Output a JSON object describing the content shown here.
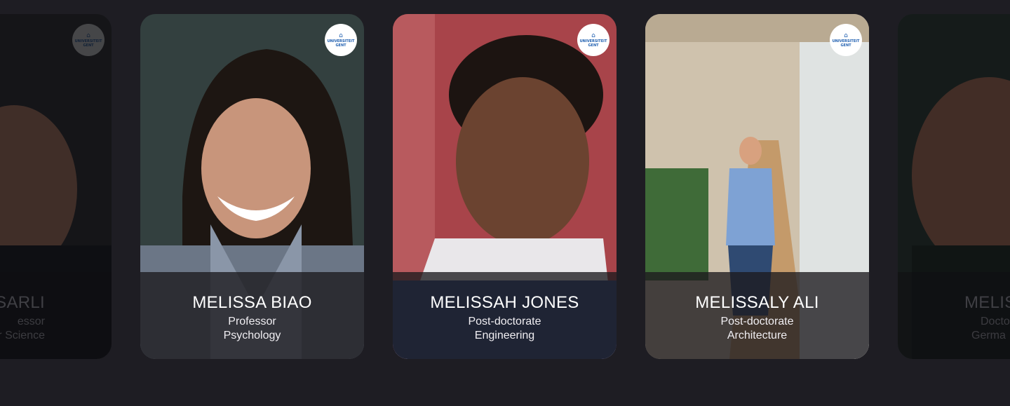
{
  "carousel": {
    "cards": [
      {
        "name": "SSARLI",
        "role": "essor",
        "dept": "r Science",
        "badge_crest": "⌂",
        "badge_text": [
          "UNIVERSITEIT",
          "GENT"
        ],
        "badge_icon": "university-logo"
      },
      {
        "name": "MELISSA BIAO",
        "role": "Professor",
        "dept": "Psychology",
        "badge_crest": "⌂",
        "badge_text": [
          "UNIVERSITEIT",
          "GENT"
        ],
        "badge_icon": "university-logo"
      },
      {
        "name": "MELISSAH JONES",
        "role": "Post-doctorate",
        "dept": "Engineering",
        "badge_crest": "⌂",
        "badge_text": [
          "UNIVERSITEIT",
          "GENT"
        ],
        "badge_icon": "university-logo"
      },
      {
        "name": "MELISSALY ALI",
        "role": "Post-doctorate",
        "dept": "Architecture",
        "badge_crest": "⌂",
        "badge_text": [
          "UNIVERSITEIT",
          "GENT"
        ],
        "badge_icon": "university-logo"
      },
      {
        "name": "MELIS",
        "role": "Docto",
        "dept": "Germa",
        "badge_crest": "",
        "badge_text": [
          "",
          ""
        ],
        "badge_icon": ""
      }
    ]
  },
  "colors": {
    "background": "#1e1d23",
    "badge_text": "#1f5fb0",
    "caption_overlay": "rgba(28,26,30,0.78)"
  }
}
